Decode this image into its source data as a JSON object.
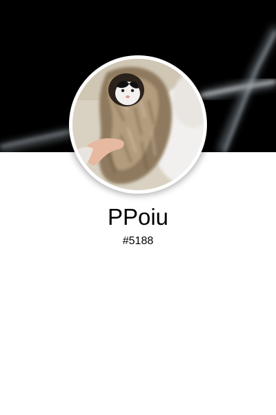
{
  "profile": {
    "username": "PPoiu",
    "discriminator": "#5188"
  },
  "icons": {
    "banner": "abstract-light-streaks-banner",
    "avatar": "cat-in-fur-coat-avatar"
  },
  "colors": {
    "banner_background": "#000000",
    "page_background": "#ffffff",
    "text": "#000000"
  }
}
